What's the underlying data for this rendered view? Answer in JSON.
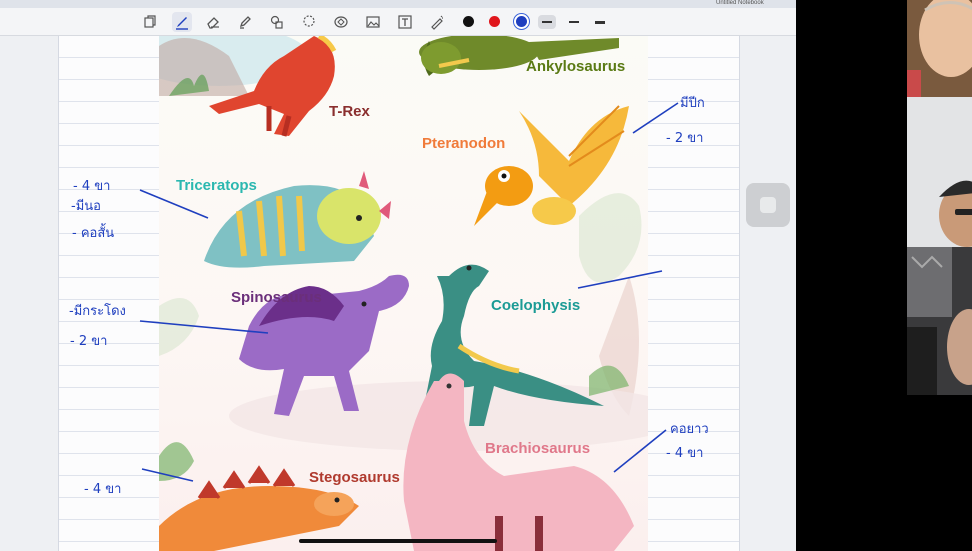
{
  "tabs": [
    "",
    "",
    "",
    "",
    "",
    "",
    "",
    "",
    "",
    "",
    "Untitled Notebook"
  ],
  "toolbar": {
    "tools": [
      "select-icon",
      "pen-icon",
      "eraser-icon",
      "highlighter-icon",
      "shapes-icon",
      "lasso-icon",
      "sticker-icon",
      "image-icon",
      "text-icon",
      "laser-pointer-icon"
    ],
    "colors": [
      "#111111",
      "#e0161c",
      "#1f3fbf"
    ],
    "selected_color": "#1f3fbf",
    "stroke_widths": [
      "medium",
      "thin",
      "thick"
    ],
    "selected_stroke": "medium"
  },
  "dinosaurs": {
    "ankylosaurus": "Ankylosaurus",
    "trex": "T-Rex",
    "pteranodon": "Pteranodon",
    "triceratops": "Triceratops",
    "spinosaurus": "Spinosaurus",
    "coelophysis": "Coelophysis",
    "brachiosaurus": "Brachiosaurus",
    "stegosaurus": "Stegosaurus"
  },
  "label_colors": {
    "ankylosaurus": "#5a7a14",
    "trex": "#8a2e2e",
    "pteranodon": "#f07b3a",
    "triceratops": "#2bb8b0",
    "spinosaurus": "#6b2f7a",
    "coelophysis": "#1b9b95",
    "brachiosaurus": "#e0788a",
    "stegosaurus": "#b03a2e"
  },
  "annotations": {
    "pteranodon_1": "มีปีก",
    "pteranodon_2": "- 2 ขา",
    "triceratops_1": "- 4 ขา",
    "triceratops_2": "-มีนอ",
    "triceratops_3": "- คอสั้น",
    "spinosaurus_1": "-มีกระโดง",
    "spinosaurus_2": "- 2 ขา",
    "brachiosaurus_1": "คอยาว",
    "brachiosaurus_2": "- 4 ขา",
    "stegosaurus_1": "- 4 ขา"
  },
  "participants": [
    "participant-1",
    "participant-2",
    "participant-3"
  ]
}
